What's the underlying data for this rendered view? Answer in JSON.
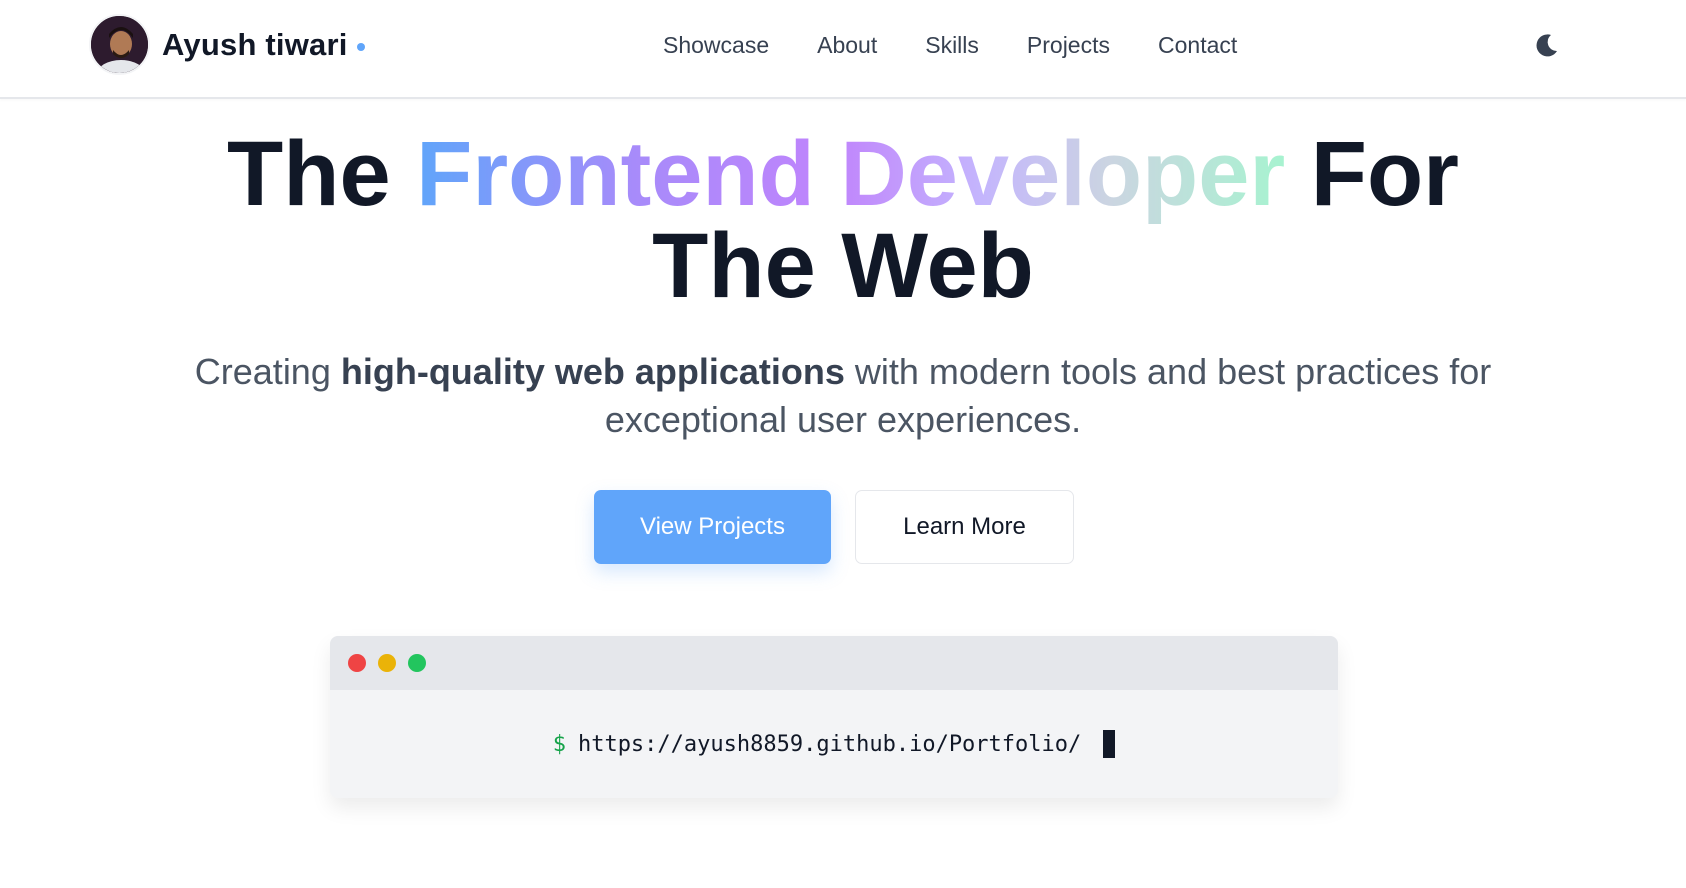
{
  "header": {
    "brand_name": "Ayush tiwari",
    "nav": [
      "Showcase",
      "About",
      "Skills",
      "Projects",
      "Contact"
    ],
    "theme_icon": "moon-icon"
  },
  "hero": {
    "title_part1": "The ",
    "title_gradient": "Frontend Developer",
    "title_part2": " For",
    "title_line2": "The Web",
    "subtitle_pre": "Creating ",
    "subtitle_bold": "high-quality web applications",
    "subtitle_post": " with modern tools and best practices for exceptional user experiences.",
    "primary_button": "View Projects",
    "secondary_button": "Learn More"
  },
  "terminal": {
    "prompt": "$",
    "command": "https://ayush8859.github.io/Portfolio/"
  },
  "colors": {
    "accent": "#60a5fa",
    "text": "#111827",
    "muted": "#4b5563"
  }
}
